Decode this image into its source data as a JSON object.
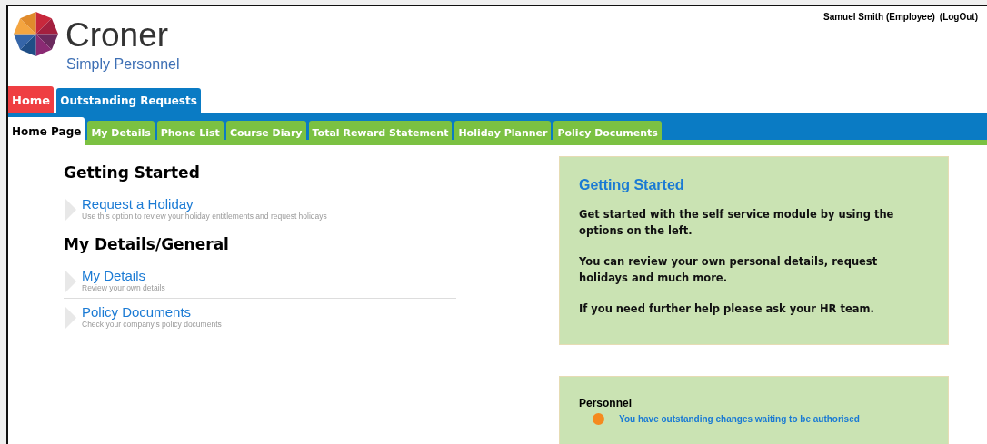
{
  "logo": {
    "name": "Croner",
    "tagline": "Simply Personnel"
  },
  "user": {
    "name": "Samuel Smith (Employee)",
    "logout": "(LogOut)"
  },
  "top_tabs": [
    {
      "label": "Home",
      "selected": true
    },
    {
      "label": "Outstanding Requests",
      "selected": false
    }
  ],
  "sub_tabs": [
    {
      "label": "Home Page",
      "selected": true
    },
    {
      "label": "My Details",
      "selected": false
    },
    {
      "label": "Phone List",
      "selected": false
    },
    {
      "label": "Course Diary",
      "selected": false
    },
    {
      "label": "Total Reward Statement",
      "selected": false
    },
    {
      "label": "Holiday Planner",
      "selected": false
    },
    {
      "label": "Policy Documents",
      "selected": false
    }
  ],
  "sections": [
    {
      "heading": "Getting Started",
      "items": [
        {
          "title": "Request a Holiday",
          "description": "Use this option to review your holiday entitlements and request holidays"
        }
      ]
    },
    {
      "heading": "My Details/General",
      "items": [
        {
          "title": "My Details",
          "description": "Review your own details"
        },
        {
          "title": "Policy Documents",
          "description": "Check your company's policy documents"
        }
      ]
    }
  ],
  "info_panel": {
    "title": "Getting Started",
    "paragraphs": [
      "Get started with the self service module by using the options on the left.",
      "You can review your own personal details, request holidays and much more.",
      "If you need further help please ask your HR team."
    ]
  },
  "notice_panel": {
    "heading": "Personnel",
    "notices": [
      {
        "text": "You have outstanding changes waiting to be authorised",
        "color": "#f58a1f"
      }
    ]
  }
}
